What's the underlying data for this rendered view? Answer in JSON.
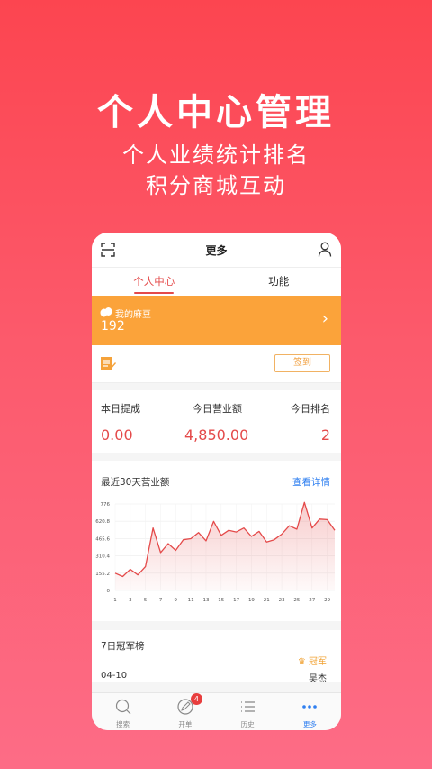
{
  "hero": {
    "title": "个人中心管理",
    "subtitle1": "个人业绩统计排名",
    "subtitle2": "积分商城互动"
  },
  "nav": {
    "title": "更多",
    "left_icon": "scan-icon",
    "right_icon": "user-icon"
  },
  "tabs": [
    {
      "label": "个人中心",
      "active": true
    },
    {
      "label": "功能",
      "active": false
    }
  ],
  "points": {
    "label": "我的麻豆",
    "value": "192",
    "color": "#fba33a"
  },
  "checkin": {
    "button_label": "签到"
  },
  "stats": [
    {
      "label": "本日提成",
      "value": "0.00"
    },
    {
      "label": "今日营业额",
      "value": "4,850.00"
    },
    {
      "label": "今日排名",
      "value": "2"
    }
  ],
  "chart_section": {
    "title": "最近30天营业额",
    "link": "查看详情"
  },
  "chart_data": {
    "type": "area",
    "x": [
      1,
      2,
      3,
      4,
      5,
      6,
      7,
      8,
      9,
      10,
      11,
      12,
      13,
      14,
      15,
      16,
      17,
      18,
      19,
      20,
      21,
      22,
      23,
      24,
      25,
      26,
      27,
      28,
      29,
      30
    ],
    "values": [
      155,
      125,
      190,
      140,
      215,
      560,
      340,
      420,
      360,
      455,
      465,
      520,
      445,
      620,
      495,
      540,
      525,
      560,
      485,
      530,
      435,
      455,
      505,
      580,
      550,
      790,
      560,
      640,
      635,
      540
    ],
    "x_tick_labels": [
      "1",
      "3",
      "5",
      "7",
      "9",
      "11",
      "13",
      "15",
      "17",
      "19",
      "21",
      "23",
      "25",
      "27",
      "29"
    ],
    "y_tick_labels": [
      "0",
      "155.2",
      "310.4",
      "465.6",
      "620.8",
      "776"
    ],
    "ylim": [
      0,
      776
    ],
    "color": "#e44a4a"
  },
  "rank": {
    "title": "7日冠军榜",
    "badge": "冠军",
    "date": "04-10",
    "name": "吴杰"
  },
  "bottom_bar": [
    {
      "label": "搜索",
      "icon": "search-icon",
      "active": false
    },
    {
      "label": "开单",
      "icon": "pen-icon",
      "active": false,
      "badge": "4"
    },
    {
      "label": "历史",
      "icon": "list-icon",
      "active": false
    },
    {
      "label": "更多",
      "icon": "more-icon",
      "active": true
    }
  ]
}
